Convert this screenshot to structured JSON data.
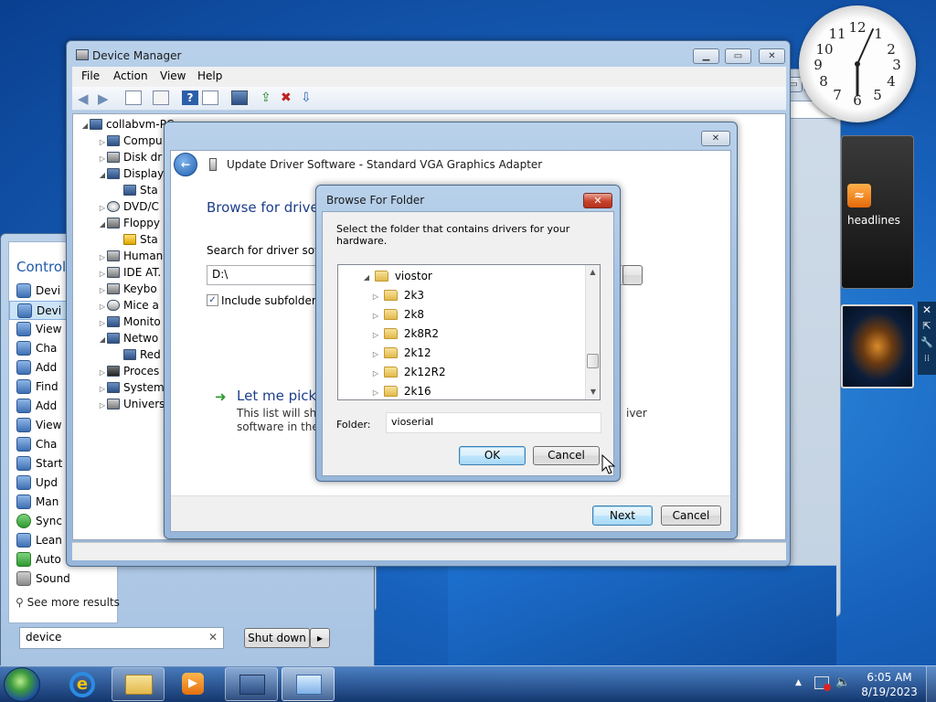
{
  "device_manager": {
    "title": "Device Manager",
    "menu": [
      "File",
      "Action",
      "View",
      "Help"
    ],
    "tree": {
      "root": "collabvm-PC",
      "items": [
        "Compu",
        "Disk dr",
        "Display",
        "Sta",
        "DVD/C",
        "Floppy",
        "Sta",
        "Human",
        "IDE AT.",
        "Keybo",
        "Mice a",
        "Monito",
        "Netwo",
        "Red",
        "Proces",
        "System",
        "Univers"
      ]
    }
  },
  "update_driver": {
    "title": "Update Driver Software - Standard VGA Graphics Adapter",
    "heading": "Browse for driver",
    "search_label": "Search for driver softwa",
    "path_value": "D:\\",
    "include_subfolders_label": "Include subfolders",
    "include_subfolders_checked": true,
    "pick_heading": "Let me pick f",
    "pick_desc_1": "This list will show",
    "pick_desc_1_end": "iver",
    "pick_desc_2": "software in the s",
    "next_label": "Next",
    "cancel_label": "Cancel"
  },
  "browse_folder": {
    "title": "Browse For Folder",
    "instruction": "Select the folder that contains drivers for your hardware.",
    "tree_parent": "viostor",
    "tree_children": [
      "2k3",
      "2k8",
      "2k8R2",
      "2k12",
      "2k12R2",
      "2k16"
    ],
    "folder_label": "Folder:",
    "folder_value": "vioserial",
    "ok_label": "OK",
    "cancel_label": "Cancel"
  },
  "control_panel": {
    "title": "Control",
    "items": [
      "Devi",
      "Devi",
      "View",
      "Cha",
      "Add",
      "Find",
      "Add",
      "View",
      "Cha",
      "Start",
      "Upd",
      "Man",
      "Sync",
      "Lean",
      "Auto",
      "Sound"
    ]
  },
  "start_menu": {
    "see_more": "See more results",
    "search_value": "device",
    "shutdown_label": "Shut down"
  },
  "gadgets": {
    "feed_headline": "headlines",
    "clock_numbers": [
      "12",
      "1",
      "2",
      "3",
      "4",
      "5",
      "6",
      "7",
      "8",
      "9",
      "10",
      "11"
    ]
  },
  "taskbar": {
    "time": "6:05 AM",
    "date": "8/19/2023"
  },
  "colors": {
    "desktop": "#1863be",
    "taskbar": "#1b3f6e",
    "close_red": "#c7422b",
    "link_blue": "#1e5aa8"
  }
}
